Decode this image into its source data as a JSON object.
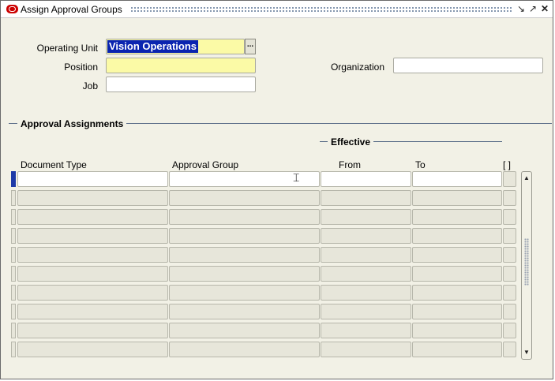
{
  "window": {
    "title": "Assign Approval Groups",
    "controls": [
      "minimize-icon",
      "maximize-icon",
      "close-icon"
    ]
  },
  "header": {
    "operating_unit_label": "Operating Unit",
    "operating_unit_value": "Vision Operations",
    "lov_label": "...",
    "position_label": "Position",
    "position_value": "",
    "job_label": "Job",
    "job_value": "",
    "organization_label": "Organization",
    "organization_value": ""
  },
  "approval_assignments": {
    "section_title": "Approval Assignments",
    "effective_title": "Effective",
    "columns": {
      "document_type": "Document Type",
      "approval_group": "Approval Group",
      "from": "From",
      "to": "To",
      "flex": "[ ]"
    },
    "row_count": 10,
    "active_row": 0
  },
  "colors": {
    "window_bg": "#f2f1e6",
    "required_field": "#fbfaa6",
    "selection": "#0a24b0",
    "section_line": "#5a6d88"
  }
}
